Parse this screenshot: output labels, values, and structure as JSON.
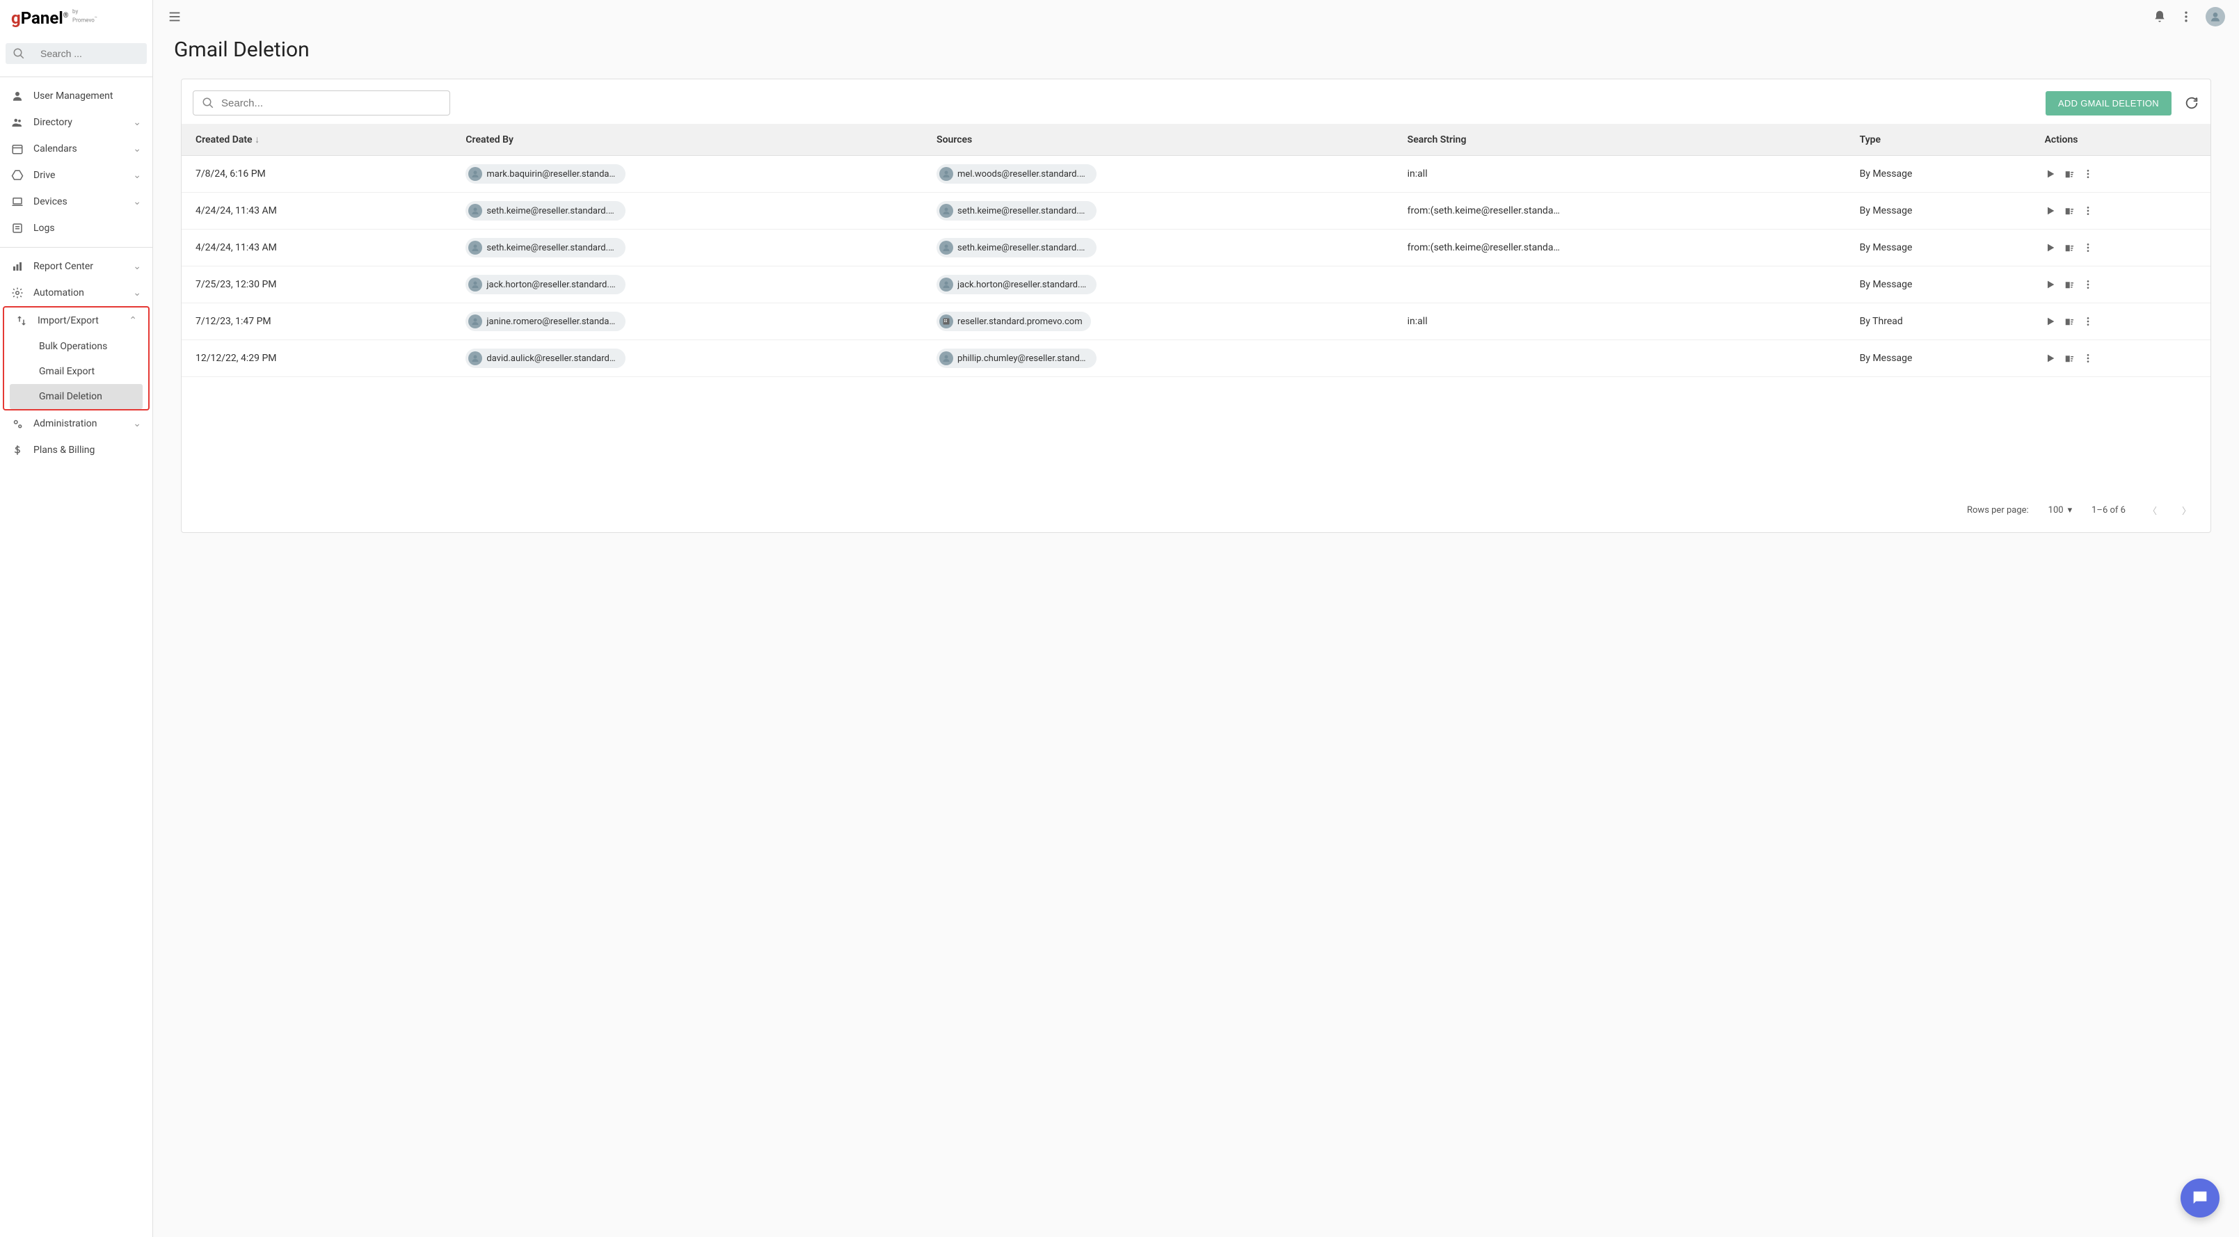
{
  "brand": {
    "g": "g",
    "panel": "Panel",
    "sub1": "by",
    "sub2": "Promevo"
  },
  "sidebar_search": {
    "placeholder": "Search ..."
  },
  "nav": {
    "user_mgmt": "User Management",
    "directory": "Directory",
    "calendars": "Calendars",
    "drive": "Drive",
    "devices": "Devices",
    "logs": "Logs",
    "report_center": "Report Center",
    "automation": "Automation",
    "import_export": "Import/Export",
    "bulk_ops": "Bulk Operations",
    "gmail_export": "Gmail Export",
    "gmail_deletion": "Gmail Deletion",
    "administration": "Administration",
    "plans_billing": "Plans & Billing"
  },
  "page": {
    "title": "Gmail Deletion"
  },
  "toolbar": {
    "search_placeholder": "Search...",
    "add_label": "ADD GMAIL DELETION"
  },
  "columns": {
    "created_date": "Created Date",
    "created_by": "Created By",
    "sources": "Sources",
    "search_string": "Search String",
    "type": "Type",
    "actions": "Actions"
  },
  "rows": [
    {
      "date": "7/8/24, 6:16 PM",
      "created_by": "mark.baquirin@reseller.standard.pro...",
      "source": "mel.woods@reseller.standard.prom...",
      "source_icon": "avatar",
      "search": "in:all",
      "type": "By Message"
    },
    {
      "date": "4/24/24, 11:43 AM",
      "created_by": "seth.keime@reseller.standard.promev...",
      "source": "seth.keime@reseller.standard.prom...",
      "source_icon": "avatar",
      "search": "from:(seth.keime@reseller.standard.pro...",
      "type": "By Message"
    },
    {
      "date": "4/24/24, 11:43 AM",
      "created_by": "seth.keime@reseller.standard.promev...",
      "source": "seth.keime@reseller.standard.prom...",
      "source_icon": "avatar",
      "search": "from:(seth.keime@reseller.standard.pro...",
      "type": "By Message"
    },
    {
      "date": "7/25/23, 12:30 PM",
      "created_by": "jack.horton@reseller.standard.promev...",
      "source": "jack.horton@reseller.standard.prom...",
      "source_icon": "avatar",
      "search": "",
      "type": "By Message"
    },
    {
      "date": "7/12/23, 1:47 PM",
      "created_by": "janine.romero@reseller.standard.pro...",
      "source": "reseller.standard.promevo.com",
      "source_icon": "domain",
      "search": "in:all",
      "type": "By Thread"
    },
    {
      "date": "12/12/22, 4:29 PM",
      "created_by": "david.aulick@reseller.standard.prome...",
      "source": "phillip.chumley@reseller.standard.pr...",
      "source_icon": "avatar",
      "search": "",
      "type": "By Message"
    }
  ],
  "footer": {
    "rows_per_page": "Rows per page:",
    "page_size": "100",
    "range": "1–6 of 6"
  }
}
